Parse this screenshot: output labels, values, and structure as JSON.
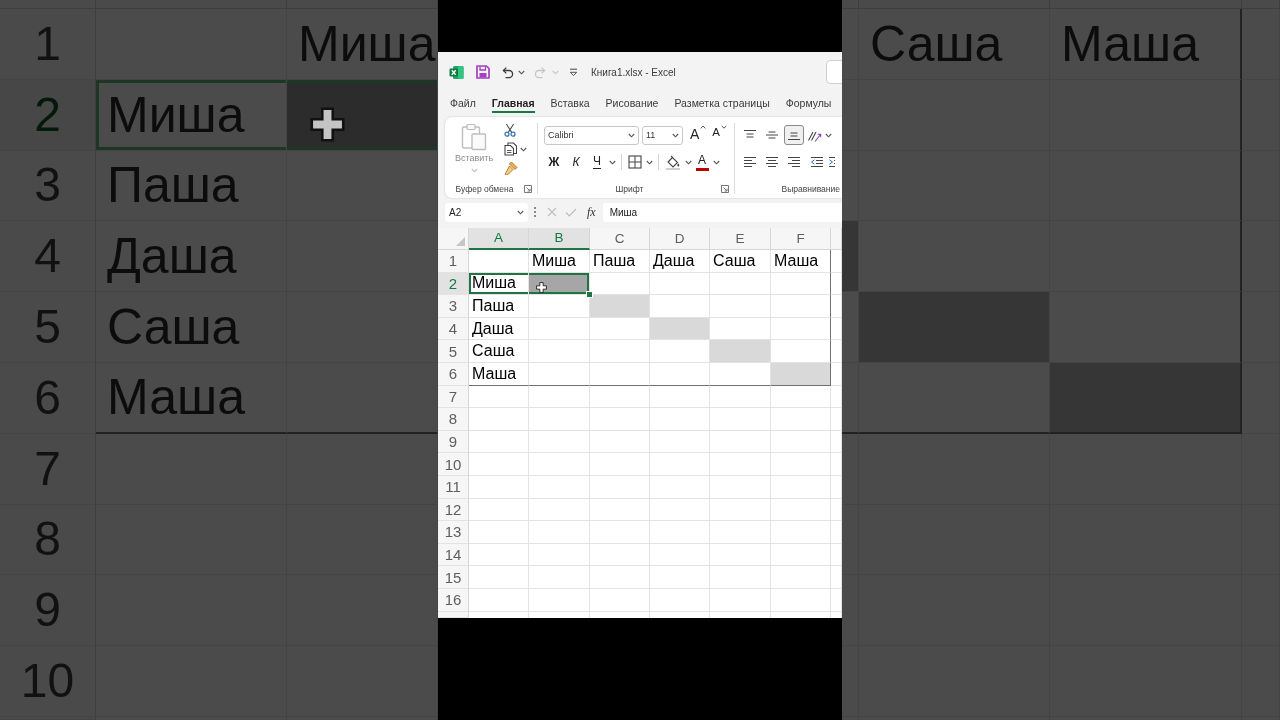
{
  "backdrop": {
    "left": {
      "rows": [
        {
          "number": "1",
          "selected": false,
          "cells": [
            null,
            {
              "text": "Миша",
              "selected": false,
              "highlighted": false
            }
          ]
        },
        {
          "number": "2",
          "selected": true,
          "cells": [
            {
              "text": "Миша",
              "selected": true,
              "highlighted": false
            },
            {
              "selected": true,
              "highlighted": true,
              "pointer": true
            }
          ]
        },
        {
          "number": "3",
          "selected": false,
          "cells": [
            {
              "text": "Паша",
              "selected": false,
              "highlighted": false
            }
          ]
        },
        {
          "number": "4",
          "selected": false,
          "cells": [
            {
              "text": "Даша",
              "selected": false,
              "highlighted": false
            }
          ]
        },
        {
          "number": "5",
          "selected": false,
          "cells": [
            {
              "text": "Саша",
              "selected": false,
              "highlighted": false
            }
          ]
        },
        {
          "number": "6",
          "selected": false,
          "cells": [
            {
              "text": "Маша",
              "selected": false,
              "highlighted": false,
              "border_bottom": true
            },
            {
              "selected": false,
              "highlighted": false,
              "border_bottom": true
            }
          ]
        },
        {
          "number": "7",
          "selected": false
        },
        {
          "number": "8",
          "selected": false
        },
        {
          "number": "9",
          "selected": false
        },
        {
          "number": "10",
          "selected": false
        }
      ]
    },
    "right": {
      "rows": [
        {
          "cells": [
            null,
            {
              "text": "Саша",
              "selected": false,
              "highlighted": false
            },
            {
              "text": "Маша",
              "selected": false,
              "highlighted": false,
              "border_right": true
            }
          ]
        },
        {
          "cells": [
            null,
            null,
            {
              "selected": false,
              "highlighted": false,
              "border_right": true
            }
          ]
        },
        {
          "cells": [
            null,
            null,
            {
              "selected": false,
              "highlighted": false,
              "border_right": true
            }
          ]
        },
        {
          "cells": [
            {
              "selected": false,
              "highlighted": true
            },
            null,
            {
              "selected": false,
              "highlighted": false,
              "border_right": true
            }
          ]
        },
        {
          "cells": [
            null,
            {
              "selected": false,
              "highlighted": true
            },
            {
              "selected": false,
              "highlighted": false,
              "border_right": true
            }
          ]
        },
        {
          "cells": [
            {
              "selected": false,
              "highlighted": false,
              "border_bottom": true
            },
            {
              "selected": false,
              "highlighted": false,
              "border_bottom": true
            },
            {
              "selected": false,
              "highlighted": true,
              "border_right": true,
              "border_bottom": true
            }
          ]
        }
      ]
    }
  },
  "app": {
    "quick_access": [
      {
        "kind": "save",
        "disabled": false
      },
      {
        "kind": "undo",
        "disabled": false,
        "menu": true
      },
      {
        "kind": "redo",
        "disabled": true,
        "menu": true
      },
      {
        "kind": "customize",
        "disabled": false
      }
    ],
    "title": "Книга1.xlsx - Excel",
    "tabs": [
      {
        "label": "Файл",
        "selected": false
      },
      {
        "label": "Главная",
        "selected": true
      },
      {
        "label": "Вставка",
        "selected": false
      },
      {
        "label": "Рисование",
        "selected": false
      },
      {
        "label": "Разметка страницы",
        "selected": false
      },
      {
        "label": "Формулы",
        "selected": false
      }
    ],
    "ribbon": {
      "clipboard": {
        "paste": {
          "label": "Вставить",
          "disabled": true,
          "menu": true
        },
        "tools": [
          {
            "kind": "cut"
          },
          {
            "kind": "copy",
            "menu": true
          },
          {
            "kind": "format_painter"
          }
        ],
        "label": "Буфер обмена",
        "launcher": true
      },
      "font": {
        "font_name": "Calibri",
        "font_size": "11",
        "size_buttons": [
          {
            "kind": "grow",
            "label": "A"
          },
          {
            "kind": "shrink",
            "label": "A"
          }
        ],
        "style_buttons": [
          {
            "kind": "bold",
            "label": "Ж"
          },
          {
            "kind": "italic",
            "label": "К"
          },
          {
            "kind": "underline",
            "label": "Ч",
            "menu": true
          }
        ],
        "tools": [
          {
            "kind": "borders",
            "menu": true
          },
          {
            "kind": "fill",
            "menu": true
          },
          {
            "kind": "font_color",
            "label": "A",
            "menu": true
          }
        ],
        "label": "Шрифт",
        "launcher": true
      },
      "alignment": {
        "vertical": [
          {
            "kind": "top",
            "selected": false
          },
          {
            "kind": "middle",
            "selected": false
          },
          {
            "kind": "bottom",
            "selected": true
          }
        ],
        "tools": [
          {
            "kind": "orientation",
            "menu": true
          }
        ],
        "horizontal": [
          {
            "kind": "left",
            "selected": false
          },
          {
            "kind": "center",
            "selected": false
          },
          {
            "kind": "right",
            "selected": false
          }
        ],
        "indent": [
          {
            "kind": "decrease"
          },
          {
            "kind": "increase"
          }
        ],
        "label": "Выравнивание"
      }
    },
    "formula_bar": {
      "name_box": "A2",
      "actions": [
        {
          "kind": "cancel",
          "disabled": true
        },
        {
          "kind": "enter",
          "disabled": true
        }
      ],
      "function_label": "fx",
      "formula": "Миша"
    },
    "sheet": {
      "columns": [
        {
          "label": "A",
          "selected": true
        },
        {
          "label": "B",
          "selected": true
        },
        {
          "label": "C",
          "selected": false
        },
        {
          "label": "D",
          "selected": false
        },
        {
          "label": "E",
          "selected": false
        },
        {
          "label": "F",
          "selected": false
        }
      ],
      "rows": [
        {
          "number": "1",
          "selected": false,
          "cells": [
            null,
            {
              "text": "Миша",
              "selected": false,
              "highlighted": false
            },
            {
              "text": "Паша",
              "selected": false,
              "highlighted": false
            },
            {
              "text": "Даша",
              "selected": false,
              "highlighted": false
            },
            {
              "text": "Саша",
              "selected": false,
              "highlighted": false
            },
            {
              "text": "Маша",
              "selected": false,
              "highlighted": false,
              "border_right": true
            }
          ]
        },
        {
          "number": "2",
          "selected": true,
          "cells": [
            {
              "text": "Миша",
              "selected": true,
              "highlighted": false
            },
            {
              "selected": true,
              "highlighted": true,
              "pointer": true
            },
            null,
            null,
            null,
            {
              "selected": false,
              "highlighted": false,
              "border_right": true
            }
          ]
        },
        {
          "number": "3",
          "selected": false,
          "cells": [
            {
              "text": "Паша",
              "selected": false,
              "highlighted": false
            },
            null,
            {
              "selected": false,
              "highlighted": true
            },
            null,
            null,
            {
              "selected": false,
              "highlighted": false,
              "border_right": true
            }
          ]
        },
        {
          "number": "4",
          "selected": false,
          "cells": [
            {
              "text": "Даша",
              "selected": false,
              "highlighted": false
            },
            null,
            null,
            {
              "selected": false,
              "highlighted": true
            },
            null,
            {
              "selected": false,
              "highlighted": false,
              "border_right": true
            }
          ]
        },
        {
          "number": "5",
          "selected": false,
          "cells": [
            {
              "text": "Саша",
              "selected": false,
              "highlighted": false
            },
            null,
            null,
            null,
            {
              "selected": false,
              "highlighted": true
            },
            {
              "selected": false,
              "highlighted": false,
              "border_right": true
            }
          ]
        },
        {
          "number": "6",
          "selected": false,
          "cells": [
            {
              "text": "Маша",
              "selected": false,
              "highlighted": false,
              "border_bottom": true
            },
            {
              "selected": false,
              "highlighted": false,
              "border_bottom": true
            },
            {
              "selected": false,
              "highlighted": false,
              "border_bottom": true
            },
            {
              "selected": false,
              "highlighted": false,
              "border_bottom": true
            },
            {
              "selected": false,
              "highlighted": false,
              "border_bottom": true
            },
            {
              "selected": false,
              "highlighted": true,
              "border_right": true,
              "border_bottom": true
            }
          ]
        },
        {
          "number": "7",
          "selected": false
        },
        {
          "number": "8",
          "selected": false
        },
        {
          "number": "9",
          "selected": false
        },
        {
          "number": "10",
          "selected": false
        },
        {
          "number": "11",
          "selected": false
        },
        {
          "number": "12",
          "selected": false
        },
        {
          "number": "13",
          "selected": false
        },
        {
          "number": "14",
          "selected": false
        },
        {
          "number": "15",
          "selected": false
        },
        {
          "number": "16",
          "selected": false
        }
      ]
    }
  }
}
